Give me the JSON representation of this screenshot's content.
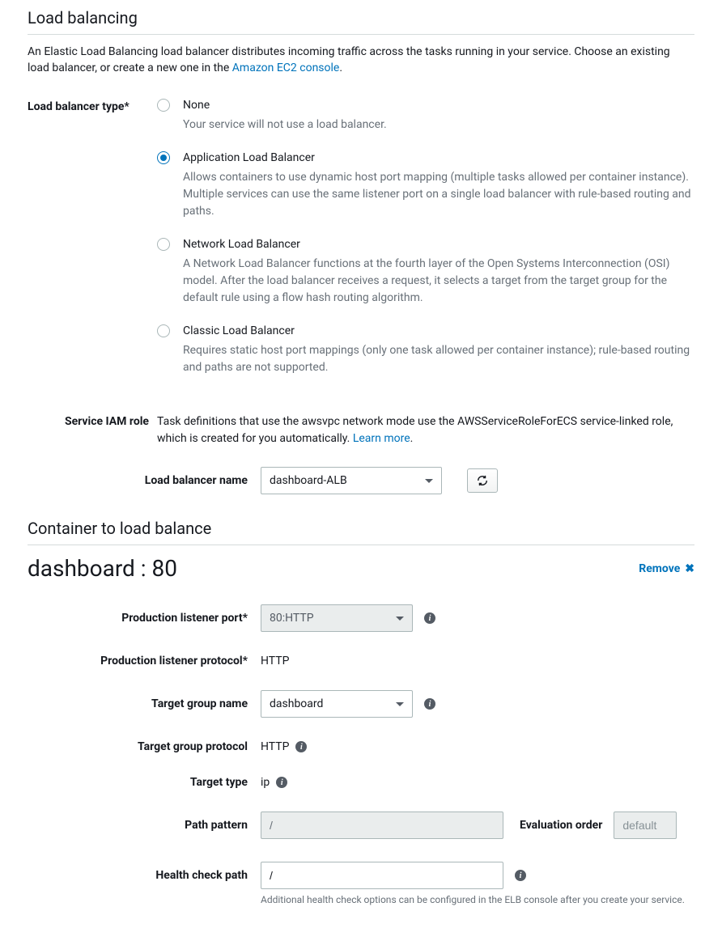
{
  "section": {
    "title": "Load balancing",
    "intro_prefix": "An Elastic Load Balancing load balancer distributes incoming traffic across the tasks running in your service. Choose an existing load balancer, or create a new one in the ",
    "intro_link": "Amazon EC2 console",
    "intro_suffix": "."
  },
  "lb_type": {
    "label": "Load balancer type*",
    "options": [
      {
        "label": "None",
        "desc": "Your service will not use a load balancer.",
        "selected": false
      },
      {
        "label": "Application Load Balancer",
        "desc": "Allows containers to use dynamic host port mapping (multiple tasks allowed per container instance). Multiple services can use the same listener port on a single load balancer with rule-based routing and paths.",
        "selected": true
      },
      {
        "label": "Network Load Balancer",
        "desc": "A Network Load Balancer functions at the fourth layer of the Open Systems Interconnection (OSI) model. After the load balancer receives a request, it selects a target from the target group for the default rule using a flow hash routing algorithm.",
        "selected": false
      },
      {
        "label": "Classic Load Balancer",
        "desc": "Requires static host port mappings (only one task allowed per container instance); rule-based routing and paths are not supported.",
        "selected": false
      }
    ]
  },
  "iam_role": {
    "label": "Service IAM role",
    "text_prefix": "Task definitions that use the awsvpc network mode use the AWSServiceRoleForECS service-linked role, which is created for you automatically. ",
    "learn_more": "Learn more",
    "text_suffix": "."
  },
  "lb_name": {
    "label": "Load balancer name",
    "value": "dashboard-ALB"
  },
  "container_section": {
    "title": "Container to load balance",
    "name": "dashboard : 80",
    "remove": "Remove"
  },
  "fields": {
    "listener_port": {
      "label": "Production listener port*",
      "value": "80:HTTP"
    },
    "listener_protocol": {
      "label": "Production listener protocol*",
      "value": "HTTP"
    },
    "tg_name": {
      "label": "Target group name",
      "value": "dashboard"
    },
    "tg_protocol": {
      "label": "Target group protocol",
      "value": "HTTP"
    },
    "target_type": {
      "label": "Target type",
      "value": "ip"
    },
    "path_pattern": {
      "label": "Path pattern",
      "value": "/",
      "eval_label": "Evaluation order",
      "eval_value": "default"
    },
    "health_check": {
      "label": "Health check path",
      "value": "/",
      "help": "Additional health check options can be configured in the ELB console after you create your service."
    }
  }
}
